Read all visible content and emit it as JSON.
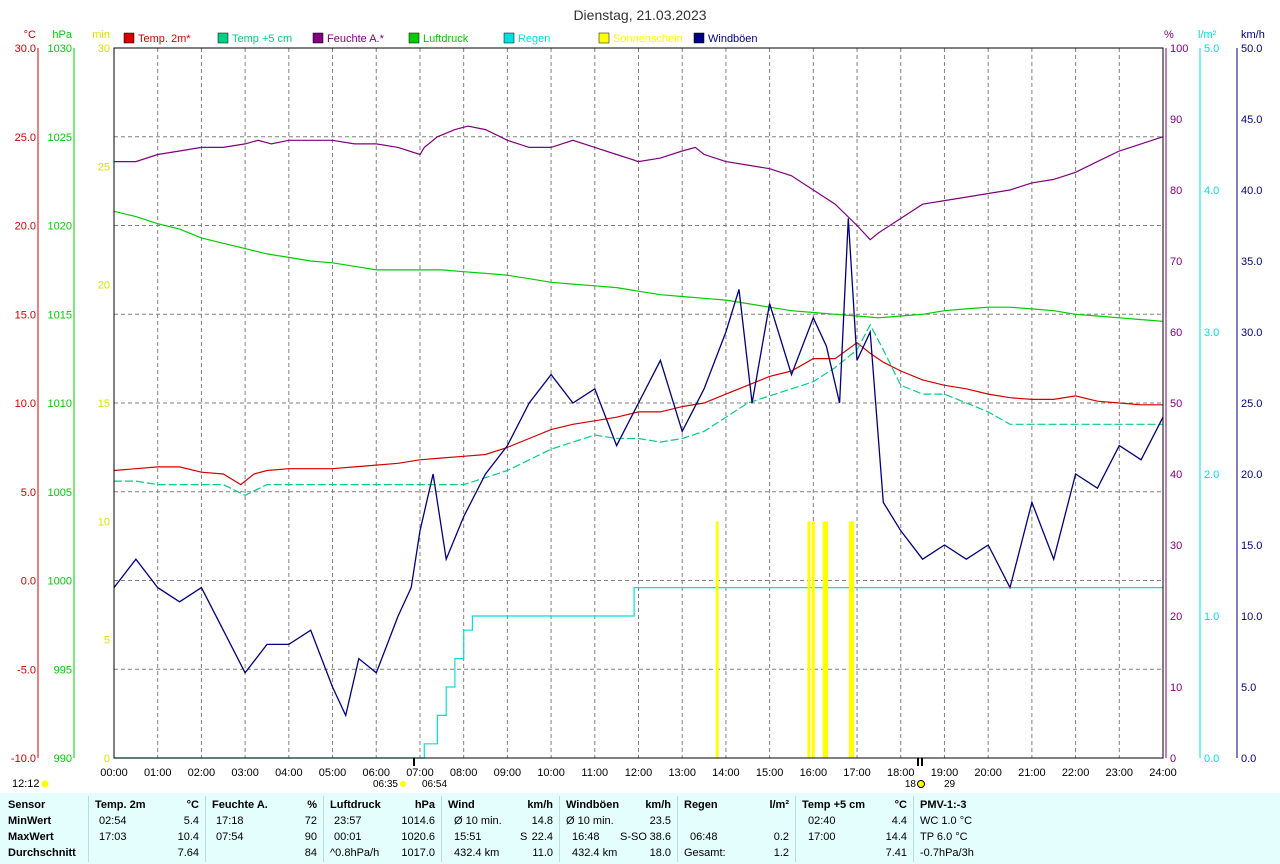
{
  "title": "Dienstag, 21.03.2023",
  "colors": {
    "temp2m": "#d40000",
    "temp5cm": "#00d080",
    "humidity": "#800080",
    "pressure": "#00cc00",
    "rain": "#00e0e0",
    "sun": "#ffff00",
    "gusts": "#000080"
  },
  "legend": [
    {
      "key": "temp2m",
      "label": "Temp. 2m*"
    },
    {
      "key": "temp5cm",
      "label": "Temp +5 cm"
    },
    {
      "key": "humidity",
      "label": "Feuchte A.*"
    },
    {
      "key": "pressure",
      "label": "Luftdruck"
    },
    {
      "key": "rain",
      "label": "Regen"
    },
    {
      "key": "sun",
      "label": "Sonnenschein"
    },
    {
      "key": "gusts",
      "label": "Windböen"
    }
  ],
  "corner_time": "12:12",
  "chart_data": {
    "type": "line",
    "x_ticks": [
      "00:00",
      "01:00",
      "02:00",
      "03:00",
      "04:00",
      "05:00",
      "06:00",
      "07:00",
      "08:00",
      "09:00",
      "10:00",
      "11:00",
      "12:00",
      "13:00",
      "14:00",
      "15:00",
      "16:00",
      "17:00",
      "18:00",
      "19:00",
      "20:00",
      "21:00",
      "22:00",
      "23:00",
      "24:00"
    ],
    "xlim": [
      0,
      24
    ],
    "axes": {
      "temp": {
        "unit": "°C",
        "ylim": [
          -10,
          30
        ],
        "ticks": [
          "30.0",
          "25.0",
          "20.0",
          "15.0",
          "10.0",
          "5.0",
          "0.0",
          "-5.0",
          "-10.0"
        ]
      },
      "press": {
        "unit": "hPa",
        "ylim": [
          990,
          1030
        ],
        "ticks": [
          "1030",
          "1025",
          "1020",
          "1015",
          "1010",
          "1005",
          "1000",
          "995",
          "990"
        ]
      },
      "sunmin": {
        "unit": "min",
        "ylim": [
          0,
          30
        ],
        "ticks": [
          "30",
          "25",
          "20",
          "15",
          "10",
          "5",
          "0"
        ]
      },
      "hum": {
        "unit": "%",
        "ylim": [
          0,
          100
        ],
        "ticks": [
          "100",
          "90",
          "80",
          "70",
          "60",
          "50",
          "40",
          "30",
          "20",
          "10",
          "0"
        ]
      },
      "rain": {
        "unit": "l/m²",
        "ylim": [
          0,
          5
        ],
        "ticks": [
          "5.0",
          "4.0",
          "3.0",
          "2.0",
          "1.0",
          "0.0"
        ]
      },
      "wind": {
        "unit": "km/h",
        "ylim": [
          0,
          50
        ],
        "ticks": [
          "50.0",
          "45.0",
          "40.0",
          "35.0",
          "30.0",
          "25.0",
          "20.0",
          "15.0",
          "10.0",
          "5.0",
          "0.0"
        ]
      }
    },
    "series": [
      {
        "key": "humidity",
        "axis": "hum",
        "x": [
          0,
          0.5,
          1,
          1.5,
          2,
          2.5,
          3,
          3.3,
          3.6,
          4,
          4.5,
          5,
          5.5,
          6,
          6.5,
          7,
          7.1,
          7.4,
          7.8,
          8.1,
          8.5,
          9,
          9.5,
          10,
          10.5,
          11,
          11.5,
          12,
          12.5,
          13,
          13.3,
          13.5,
          14,
          14.5,
          15,
          15.5,
          16,
          16.5,
          17,
          17.3,
          17.5,
          18,
          18.5,
          19,
          19.5,
          20,
          20.5,
          21,
          21.5,
          22,
          22.5,
          23,
          23.5,
          24
        ],
        "y": [
          84,
          84,
          85,
          85.5,
          86,
          86,
          86.5,
          87,
          86.5,
          87,
          87,
          87,
          86.5,
          86.5,
          86,
          85,
          86,
          87.5,
          88.5,
          89,
          88.5,
          87,
          86,
          86,
          87,
          86,
          85,
          84,
          84.5,
          85.5,
          86,
          85,
          84,
          83.5,
          83,
          82,
          80,
          78,
          75,
          73,
          74,
          76,
          78,
          78.5,
          79,
          79.5,
          80,
          81,
          81.5,
          82.5,
          84,
          85.5,
          86.5,
          87.5
        ]
      },
      {
        "key": "pressure",
        "axis": "press",
        "x": [
          0,
          0.5,
          1,
          1.5,
          2,
          2.5,
          3,
          3.5,
          4,
          4.5,
          5,
          5.5,
          6,
          6.5,
          7,
          7.5,
          8,
          8.5,
          9,
          9.5,
          10,
          10.5,
          11,
          11.5,
          12,
          12.5,
          13,
          13.5,
          14,
          14.5,
          15,
          15.5,
          16,
          16.5,
          17,
          17.5,
          18,
          18.5,
          19,
          19.5,
          20,
          20.5,
          21,
          21.5,
          22,
          22.5,
          23,
          23.5,
          24
        ],
        "y": [
          1020.8,
          1020.5,
          1020.1,
          1019.8,
          1019.3,
          1019,
          1018.7,
          1018.4,
          1018.2,
          1018,
          1017.9,
          1017.7,
          1017.5,
          1017.5,
          1017.5,
          1017.5,
          1017.4,
          1017.3,
          1017.2,
          1017,
          1016.8,
          1016.7,
          1016.6,
          1016.5,
          1016.3,
          1016.1,
          1016,
          1015.9,
          1015.8,
          1015.6,
          1015.4,
          1015.2,
          1015.1,
          1015,
          1014.9,
          1014.8,
          1014.9,
          1015,
          1015.2,
          1015.3,
          1015.4,
          1015.4,
          1015.3,
          1015.2,
          1015,
          1014.9,
          1014.8,
          1014.7,
          1014.6
        ]
      },
      {
        "key": "temp2m",
        "axis": "temp",
        "x": [
          0,
          0.5,
          1,
          1.5,
          2,
          2.5,
          2.9,
          3.2,
          3.5,
          4,
          4.5,
          5,
          5.5,
          6,
          6.5,
          7,
          7.5,
          8,
          8.5,
          9,
          9.5,
          10,
          10.5,
          11,
          11.5,
          12,
          12.5,
          13,
          13.5,
          14,
          14.5,
          15,
          15.5,
          16,
          16.5,
          17,
          17.3,
          17.6,
          18,
          18.5,
          19,
          19.5,
          20,
          20.5,
          21,
          21.5,
          22,
          22.5,
          23,
          23.5,
          24
        ],
        "y": [
          6.2,
          6.3,
          6.4,
          6.4,
          6.1,
          6.0,
          5.4,
          6.0,
          6.2,
          6.3,
          6.3,
          6.3,
          6.4,
          6.5,
          6.6,
          6.8,
          6.9,
          7.0,
          7.1,
          7.5,
          8.0,
          8.5,
          8.8,
          9.0,
          9.2,
          9.5,
          9.5,
          9.8,
          10.0,
          10.5,
          11.0,
          11.5,
          11.8,
          12.5,
          12.5,
          13.4,
          12.8,
          12.3,
          11.8,
          11.3,
          11.0,
          10.8,
          10.5,
          10.3,
          10.2,
          10.2,
          10.4,
          10.1,
          10.0,
          9.9,
          9.9
        ]
      },
      {
        "key": "temp5cm",
        "axis": "temp",
        "x": [
          0,
          0.5,
          1,
          1.5,
          2,
          2.5,
          3,
          3.5,
          4,
          4.5,
          5,
          5.5,
          6,
          6.5,
          7,
          7.5,
          8,
          8.5,
          9,
          9.5,
          10,
          10.5,
          11,
          11.5,
          12,
          12.5,
          13,
          13.5,
          14,
          14.5,
          15,
          15.5,
          16,
          16.5,
          17,
          17.3,
          17.6,
          18,
          18.5,
          19,
          19.5,
          20,
          20.5,
          21,
          21.5,
          22,
          22.5,
          23,
          23.5,
          24
        ],
        "y": [
          5.6,
          5.6,
          5.4,
          5.4,
          5.4,
          5.4,
          4.8,
          5.4,
          5.4,
          5.4,
          5.4,
          5.4,
          5.4,
          5.4,
          5.4,
          5.4,
          5.4,
          5.8,
          6.2,
          6.8,
          7.4,
          7.8,
          8.2,
          8.0,
          8.0,
          7.8,
          8.0,
          8.4,
          9.2,
          10.0,
          10.4,
          10.8,
          11.2,
          12.0,
          13.0,
          14.4,
          13.0,
          11.0,
          10.5,
          10.5,
          10.0,
          9.5,
          8.8,
          8.8,
          8.8,
          8.8,
          8.8,
          8.8,
          8.8,
          8.8
        ]
      },
      {
        "key": "rain",
        "axis": "rain",
        "x": [
          0,
          6.8,
          7.1,
          7.4,
          7.6,
          7.8,
          8.0,
          8.2,
          8.5,
          9,
          10,
          11,
          11.85,
          11.9,
          12.5,
          13,
          14,
          15,
          16,
          17,
          18,
          19,
          20,
          21,
          22,
          23,
          24
        ],
        "y": [
          0,
          0,
          0.1,
          0.3,
          0.5,
          0.7,
          0.9,
          1.0,
          1.0,
          1.0,
          1.0,
          1.0,
          1.0,
          1.2,
          1.2,
          1.2,
          1.2,
          1.2,
          1.2,
          1.2,
          1.2,
          1.2,
          1.2,
          1.2,
          1.2,
          1.2,
          1.2
        ]
      },
      {
        "key": "gusts",
        "axis": "wind",
        "x": [
          0,
          0.5,
          1,
          1.5,
          2,
          2.5,
          3,
          3.5,
          4,
          4.5,
          5,
          5.3,
          5.6,
          6,
          6.5,
          6.8,
          7,
          7.3,
          7.6,
          8,
          8.5,
          9,
          9.5,
          10,
          10.5,
          11,
          11.5,
          12,
          12.5,
          13,
          13.5,
          14,
          14.3,
          14.6,
          15,
          15.5,
          16,
          16.3,
          16.6,
          16.8,
          17,
          17.3,
          17.6,
          18,
          18.5,
          19,
          19.5,
          20,
          20.5,
          21,
          21.5,
          22,
          22.5,
          23,
          23.5,
          24
        ],
        "y": [
          12,
          14,
          12,
          11,
          12,
          9,
          6,
          8,
          8,
          9,
          5,
          3,
          7,
          6,
          10,
          12,
          16,
          20,
          14,
          17,
          20,
          22,
          25,
          27,
          25,
          26,
          22,
          25,
          28,
          23,
          26,
          30,
          33,
          25,
          32,
          27,
          31,
          29,
          25,
          38,
          28,
          30,
          18,
          16,
          14,
          15,
          14,
          15,
          12,
          18,
          14,
          20,
          19,
          22,
          21,
          24
        ]
      },
      {
        "key": "sun",
        "axis": "sunmin",
        "bars": [
          [
            13.8,
            10
          ],
          [
            15.9,
            10
          ],
          [
            16.0,
            10
          ],
          [
            16.25,
            10
          ],
          [
            16.3,
            10
          ],
          [
            16.85,
            10
          ],
          [
            16.9,
            10
          ]
        ]
      }
    ]
  },
  "sun_markers": {
    "sunrise": "06:35",
    "sunrise2": "06:54",
    "sunset": "18:29",
    "sunset_short": "29",
    "sunset_prefix": "18"
  },
  "stats": {
    "sensor": {
      "h": "Sensor",
      "r1": "MinWert",
      "r2": "MaxWert",
      "r3": "Durchschnitt"
    },
    "temp2m": {
      "h": "Temp. 2m",
      "u": "°C",
      "r1t": "02:54",
      "r1v": "5.4",
      "r2t": "17:03",
      "r2v": "10.4",
      "r3v": "7.64"
    },
    "hum": {
      "h": "Feuchte A.",
      "u": "%",
      "r1t": "17:18",
      "r1v": "72",
      "r2t": "07:54",
      "r2v": "90",
      "r3v": "84"
    },
    "press": {
      "h": "Luftdruck",
      "u": "hPa",
      "r1t": "23:57",
      "r1v": "1014.6",
      "r2t": "00:01",
      "r2v": "1020.6",
      "r3t": "^0.8hPa/h",
      "r3v": "1017.0"
    },
    "wind": {
      "h": "Wind",
      "u": "km/h",
      "r1t": "Ø 10 min.",
      "r1v": "14.8",
      "r2t": "15:51",
      "r2d": "S",
      "r2v": "22.4",
      "r3t": "432.4 km",
      "r3v": "11.0"
    },
    "gust": {
      "h": "Windböen",
      "u": "km/h",
      "r1t": "Ø 10 min.",
      "r1v": "23.5",
      "r2t": "16:48",
      "r2d": "S-SO",
      "r2v": "38.6",
      "r3t": "432.4 km",
      "r3v": "18.0"
    },
    "rain": {
      "h": "Regen",
      "u": "l/m²",
      "r2t": "06:48",
      "r2v": "0.2",
      "r3t": "Gesamt:",
      "r3v": "1.2"
    },
    "temp5": {
      "h": "Temp +5 cm",
      "u": "°C",
      "r1t": "02:40",
      "r1v": "4.4",
      "r2t": "17:00",
      "r2v": "14.4",
      "r3v": "7.41"
    },
    "pmv": {
      "h": "PMV-1:-3",
      "r1": "WC 1.0 °C",
      "r2": "TP 6.0 °C",
      "r3": "-0.7hPa/3h"
    }
  }
}
